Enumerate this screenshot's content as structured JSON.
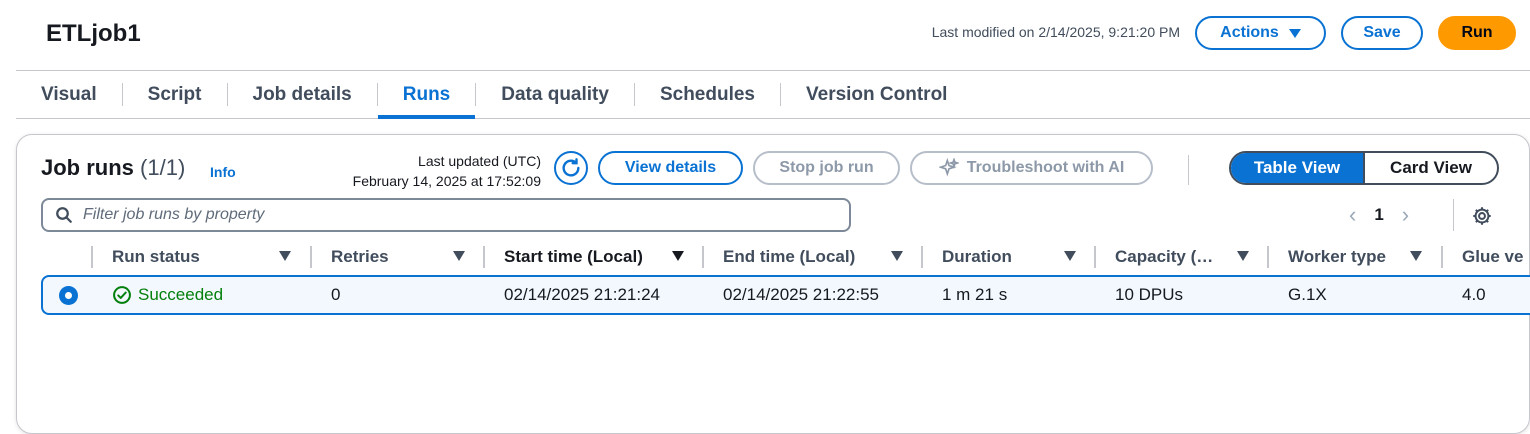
{
  "header": {
    "job_title": "ETLjob1",
    "last_modified": "Last modified on 2/14/2025, 9:21:20 PM",
    "actions_label": "Actions",
    "save_label": "Save",
    "run_label": "Run"
  },
  "tabs": [
    {
      "label": "Visual"
    },
    {
      "label": "Script"
    },
    {
      "label": "Job details"
    },
    {
      "label": "Runs",
      "active": true
    },
    {
      "label": "Data quality"
    },
    {
      "label": "Schedules"
    },
    {
      "label": "Version Control"
    }
  ],
  "panel": {
    "title": "Job runs",
    "count": "(1/1)",
    "info": "Info",
    "last_updated_label": "Last updated (UTC)",
    "last_updated_value": "February 14, 2025 at 17:52:09",
    "view_details_label": "View details",
    "stop_run_label": "Stop job run",
    "troubleshoot_label": "Troubleshoot with AI",
    "table_view_label": "Table View",
    "card_view_label": "Card View",
    "filter_placeholder": "Filter job runs by property",
    "page": "1"
  },
  "table": {
    "columns": [
      "Run status",
      "Retries",
      "Start time (Local)",
      "End time (Local)",
      "Duration",
      "Capacity (…",
      "Worker type",
      "Glue ve"
    ],
    "rows": [
      {
        "status": "Succeeded",
        "retries": "0",
        "start": "02/14/2025 21:21:24",
        "end": "02/14/2025 21:22:55",
        "duration": "1 m 21 s",
        "capacity": "10 DPUs",
        "worker": "G.1X",
        "glue": "4.0"
      }
    ]
  },
  "colors": {
    "accent": "#0972d3",
    "run_button": "#ff9900",
    "success": "#037f0c",
    "selected_row_bg": "#f2f8fd"
  }
}
